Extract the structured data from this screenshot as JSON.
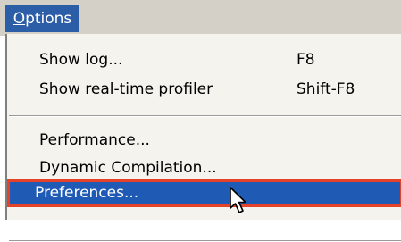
{
  "menubar": {
    "options": {
      "label_first": "O",
      "label_rest": "ptions"
    }
  },
  "menu": {
    "items": [
      {
        "label": "Show log...",
        "shortcut": "F8"
      },
      {
        "label": "Show real-time profiler",
        "shortcut": "Shift-F8"
      },
      {
        "label": "Performance..."
      },
      {
        "label": "Dynamic Compilation..."
      },
      {
        "label": "Preferences...",
        "highlighted": true
      }
    ]
  },
  "colors": {
    "menubar_bg": "#d4d0c8",
    "menu_bg": "#f5f3ed",
    "highlight": "#1f5bb5",
    "callout_border": "#e4432a"
  },
  "icons": {
    "pointer": "mouse-pointer-icon"
  }
}
